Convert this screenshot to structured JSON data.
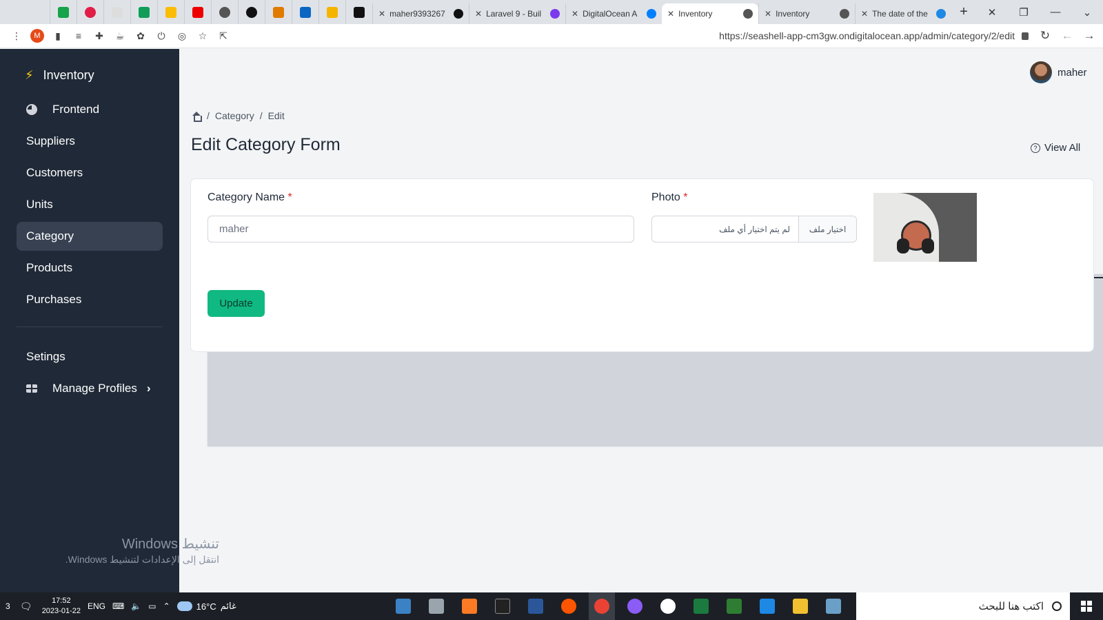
{
  "browser": {
    "tabs": [
      {
        "title": "The date of the",
        "active": false
      },
      {
        "title": "Inventory",
        "active": false
      },
      {
        "title": "Inventory",
        "active": true
      },
      {
        "title": "DigitalOcean A",
        "active": false
      },
      {
        "title": "Laravel 9 - Buil",
        "active": false
      },
      {
        "title": "maher9393267",
        "active": false
      }
    ],
    "url": "https://seashell-app-cm3gw.ondigitalocean.app/admin/category/2/edit",
    "profile_initial": "M"
  },
  "sidebar": {
    "brand": "Inventory",
    "items": [
      {
        "label": "Frontend",
        "icon": "pie-chart-icon"
      },
      {
        "label": "Suppliers",
        "icon": "credit-card-icon"
      },
      {
        "label": "Customers",
        "icon": "credit-card-icon"
      },
      {
        "label": "Units",
        "icon": "credit-card-icon"
      },
      {
        "label": "Category",
        "icon": "credit-card-icon",
        "active": true
      },
      {
        "label": "Products",
        "icon": "credit-card-icon"
      },
      {
        "label": "Purchases",
        "icon": "credit-card-icon"
      }
    ],
    "bottom_items": [
      {
        "label": "Setings",
        "icon": "credit-card-icon"
      },
      {
        "label": "Manage Profiles",
        "icon": "table-icon"
      }
    ]
  },
  "header": {
    "username": "maher"
  },
  "breadcrumb": {
    "items": [
      "Category",
      "Edit"
    ]
  },
  "page": {
    "title": "Edit Category Form",
    "view_all": "View All"
  },
  "form": {
    "name_label": "Category Name",
    "name_value": "maher",
    "photo_label": "Photo",
    "required_mark": "*",
    "file_button": "اختيار ملف",
    "file_status": "لم يتم اختيار أي ملف",
    "submit_label": "Update"
  },
  "watermark": {
    "line1": "تنشيط Windows",
    "line2": "انتقل إلى الإعدادات لتنشيط Windows."
  },
  "taskbar": {
    "search_placeholder": "اكتب هنا للبحث",
    "weather_temp": "16°C",
    "weather_desc": "غائم",
    "lang": "ENG",
    "time": "17:52",
    "date": "2023-01-22",
    "notifications": "3"
  },
  "colors": {
    "sidebar_bg": "#1f2937",
    "accent": "#10b981",
    "required": "#dc2626"
  }
}
